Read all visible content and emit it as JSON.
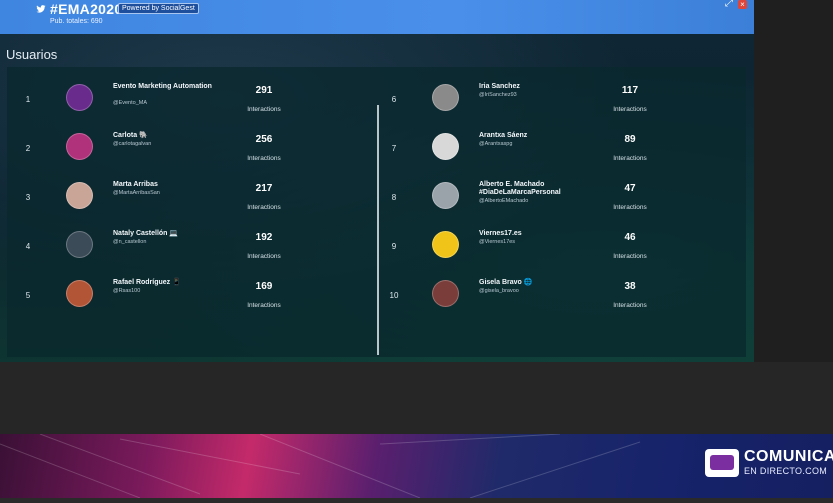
{
  "header": {
    "hashtag": "#EMA2020",
    "powered_by": "Powered by SocialGest",
    "pub_totals": "Pub. totales: 690",
    "twitter_icon": "twitter-bird-icon",
    "expand_icon": "expand-icon",
    "close_icon": "close-icon",
    "accent": "#3f86e0"
  },
  "section": {
    "title": "Usuarios"
  },
  "caption_label": "Interactions",
  "users_left": [
    {
      "rank": "1",
      "name": "Evento Marketing Automation",
      "handle": "@Evento_MA",
      "count": "291",
      "avatar_color": "#6a2c8c"
    },
    {
      "rank": "2",
      "name": "Carlota 🐘",
      "handle": "@carlotagalvan",
      "count": "256",
      "avatar_color": "#b0327a"
    },
    {
      "rank": "3",
      "name": "Marta Arribas",
      "handle": "@MartaArribasSan",
      "count": "217",
      "avatar_color": "#c9a597"
    },
    {
      "rank": "4",
      "name": "Nataly Castellón 💻",
      "handle": "@n_castellon",
      "count": "192",
      "avatar_color": "#3b4b58"
    },
    {
      "rank": "5",
      "name": "Rafael Rodríguez 📱",
      "handle": "@Rsas100",
      "count": "169",
      "avatar_color": "#b25537"
    }
  ],
  "users_right": [
    {
      "rank": "6",
      "name": "Iria Sanchez",
      "handle": "@IriSanchez93",
      "count": "117",
      "avatar_color": "#8a8a8a"
    },
    {
      "rank": "7",
      "name": "Arantxa Sáenz",
      "handle": "@Arantxaspg",
      "count": "89",
      "avatar_color": "#d8d8d8"
    },
    {
      "rank": "8",
      "name": "Alberto E. Machado #DiaDeLaMarcaPersonal",
      "handle": "@AlbertoEMachado",
      "count": "47",
      "avatar_color": "#9aa3aa"
    },
    {
      "rank": "9",
      "name": "Viernes17.es",
      "handle": "@Viernes17es",
      "count": "46",
      "avatar_color": "#f0c419"
    },
    {
      "rank": "10",
      "name": "Gisela Bravo 🌐",
      "handle": "@gisela_bravoo",
      "count": "38",
      "avatar_color": "#7a3d3a"
    }
  ],
  "branding": {
    "title": "COMUNICA",
    "subtitle": "EN DIRECTO.COM",
    "logo_icon": "tv-face-logo-icon"
  }
}
